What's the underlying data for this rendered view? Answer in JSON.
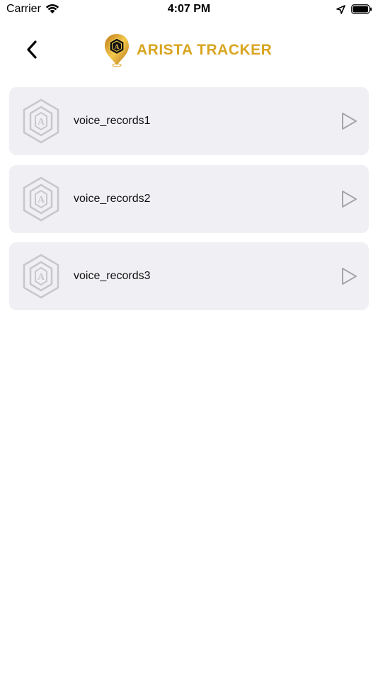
{
  "status_bar": {
    "carrier": "Carrier",
    "time": "4:07 PM"
  },
  "header": {
    "title": "ARISTA TRACKER",
    "title_color": "#d9a520"
  },
  "records": [
    {
      "label": "voice_records1"
    },
    {
      "label": "voice_records2"
    },
    {
      "label": "voice_records3"
    }
  ],
  "icons": {
    "back": "chevron-left-icon",
    "row": "arista-hexagon-logo-icon",
    "play": "play-icon"
  }
}
